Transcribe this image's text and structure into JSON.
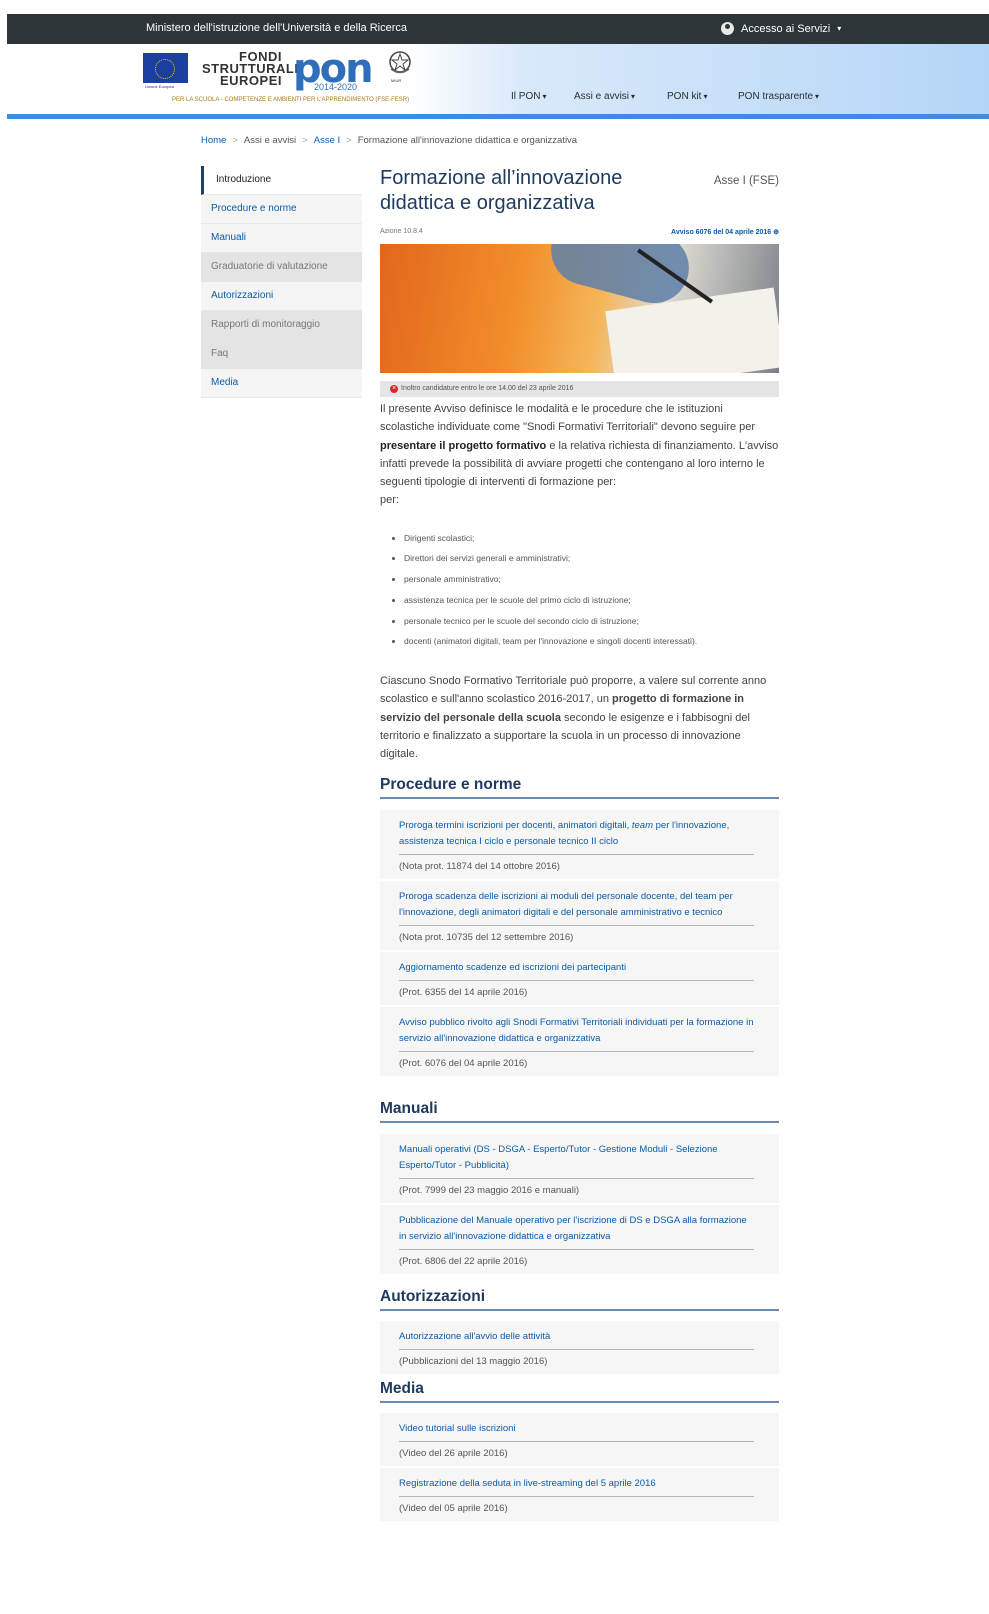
{
  "topbar": {
    "ministry": "Ministero dell'istruzione dell'Università e della Ricerca",
    "access": "Accesso ai Servizi",
    "access_caret": "▾"
  },
  "header": {
    "eu_caption": "Unione Europea",
    "fondi": "FONDI\nSTRUTTURALI\nEUROPEI",
    "pon": "pon",
    "pon_years": "2014-2020",
    "miur_caption": "MIUR",
    "tagline": "PER LA SCUOLA - COMPETENZE E AMBIENTI PER L'APPRENDIMENTO (FSE-FESR)",
    "nav": [
      {
        "label": "Il PON",
        "caret": "▾"
      },
      {
        "label": "Assi e avvisi",
        "caret": "▾"
      },
      {
        "label": "PON kit",
        "caret": "▾"
      },
      {
        "label": "PON trasparente",
        "caret": "▾"
      }
    ]
  },
  "breadcrumb": {
    "home": "Home",
    "assi": "Assi e avvisi",
    "asse": "Asse I",
    "current": "Formazione all'innovazione didattica e organizzativa",
    "sep": ">"
  },
  "sidebar": {
    "items": [
      {
        "label": "Introduzione"
      },
      {
        "label": "Procedure e norme"
      },
      {
        "label": "Manuali"
      },
      {
        "label": "Graduatorie di valutazione"
      },
      {
        "label": "Autorizzazioni"
      },
      {
        "label": "Rapporti di monitoraggio"
      },
      {
        "label": "Faq"
      },
      {
        "label": "Media"
      }
    ]
  },
  "main": {
    "title": "Formazione all’innovazione didattica e organizzativa",
    "asse_label": "Asse I (FSE)",
    "azione": "Azione 10.8.4",
    "avviso": "Avviso 6076 del 04 aprile 2016",
    "avviso_icon": "⊕",
    "notice": "Inoltro candidature entro le ore 14.00 del 23 aprile 2016",
    "p1_a": "Il presente Avviso definisce le modalità e le procedure che le istituzioni scolastiche individuate come \"Snodi Formativi Territoriali\" devono seguire per ",
    "p1_b": "presentare il progetto formativo",
    "p1_c": " e la relativa richiesta di finanziamento. L'avviso infatti prevede la possibilità di avviare progetti che contengano al loro interno le seguenti tipologie di interventi di formazione per:",
    "p1_d": "per:",
    "list": [
      "Dirigenti scolastici;",
      "Direttori dei servizi generali e amministrativi;",
      "personale amministrativo;",
      "assistenza tecnica per le scuole del primo ciclo di istruzione;",
      "personale tecnico per le scuole del secondo ciclo di istruzione;",
      "docenti (animatori digitali, team per l'innovazione e singoli docenti interessati)."
    ],
    "p2_a": "Ciascuno Snodo Formativo Territoriale può proporre, a valere sul corrente anno scolastico e sull'anno scolastico 2016-2017, un ",
    "p2_b": "progetto di formazione in servizio del personale della scuola",
    "p2_c": " secondo le esigenze e i fabbisogni del territorio e finalizzato a supportare la scuola in un processo di innovazione digitale."
  },
  "sections": {
    "procedure": {
      "heading": "Procedure e norme",
      "items": [
        {
          "title_a": "Proroga termini iscrizioni per docenti, animatori digitali, ",
          "title_em": "team",
          "title_b": " per l'innovazione, assistenza tecnica I ciclo e personale tecnico II ciclo",
          "sub": "(Nota prot. 11874 del 14 ottobre 2016)"
        },
        {
          "title_a": "Proroga scadenza delle iscrizioni ai moduli del personale docente, del team per l'innovazione, degli animatori digitali e del personale amministrativo e tecnico",
          "title_em": "",
          "title_b": "",
          "sub": "(Nota prot. 10735 del 12 settembre 2016)"
        },
        {
          "title_a": "Aggiornamento scadenze ed iscrizioni dei partecipanti",
          "title_em": "",
          "title_b": "",
          "sub": "(Prot. 6355 del 14 aprile 2016)"
        },
        {
          "title_a": "Avviso pubblico rivolto agli Snodi Formativi Territoriali individuati per la formazione in servizio all'innovazione didattica e organizzativa",
          "title_em": "",
          "title_b": "",
          "sub": "(Prot. 6076 del 04 aprile 2016)"
        }
      ]
    },
    "manuali": {
      "heading": "Manuali",
      "items": [
        {
          "title": "Manuali operativi (DS - DSGA - Esperto/Tutor - Gestione Moduli - Selezione Esperto/Tutor - Pubblicità)",
          "sub": "(Prot. 7999 del 23 maggio 2016 e manuali)"
        },
        {
          "title": "Pubblicazione del Manuale operativo per l'iscrizione di DS e DSGA alla formazione in servizio all'innovazione didattica e organizzativa",
          "sub": "(Prot. 6806 del 22 aprile 2016)"
        }
      ]
    },
    "autorizzazioni": {
      "heading": "Autorizzazioni",
      "items": [
        {
          "title": "Autorizzazione all'avvio delle attività",
          "sub": "(Pubblicazioni del 13 maggio 2016)"
        }
      ]
    },
    "media": {
      "heading": "Media",
      "items": [
        {
          "title": "Video tutorial sulle iscrizioni",
          "sub": "(Video del 26 aprile 2016)"
        },
        {
          "title": "Registrazione della seduta in live-streaming del 5 aprile 2016",
          "sub": "(Video del 05 aprile 2016)"
        }
      ]
    }
  },
  "colors": {
    "topbar": "#2d3538",
    "accent": "#3e8be0",
    "link": "#0a5ba8",
    "heading": "#1e3a5f"
  }
}
